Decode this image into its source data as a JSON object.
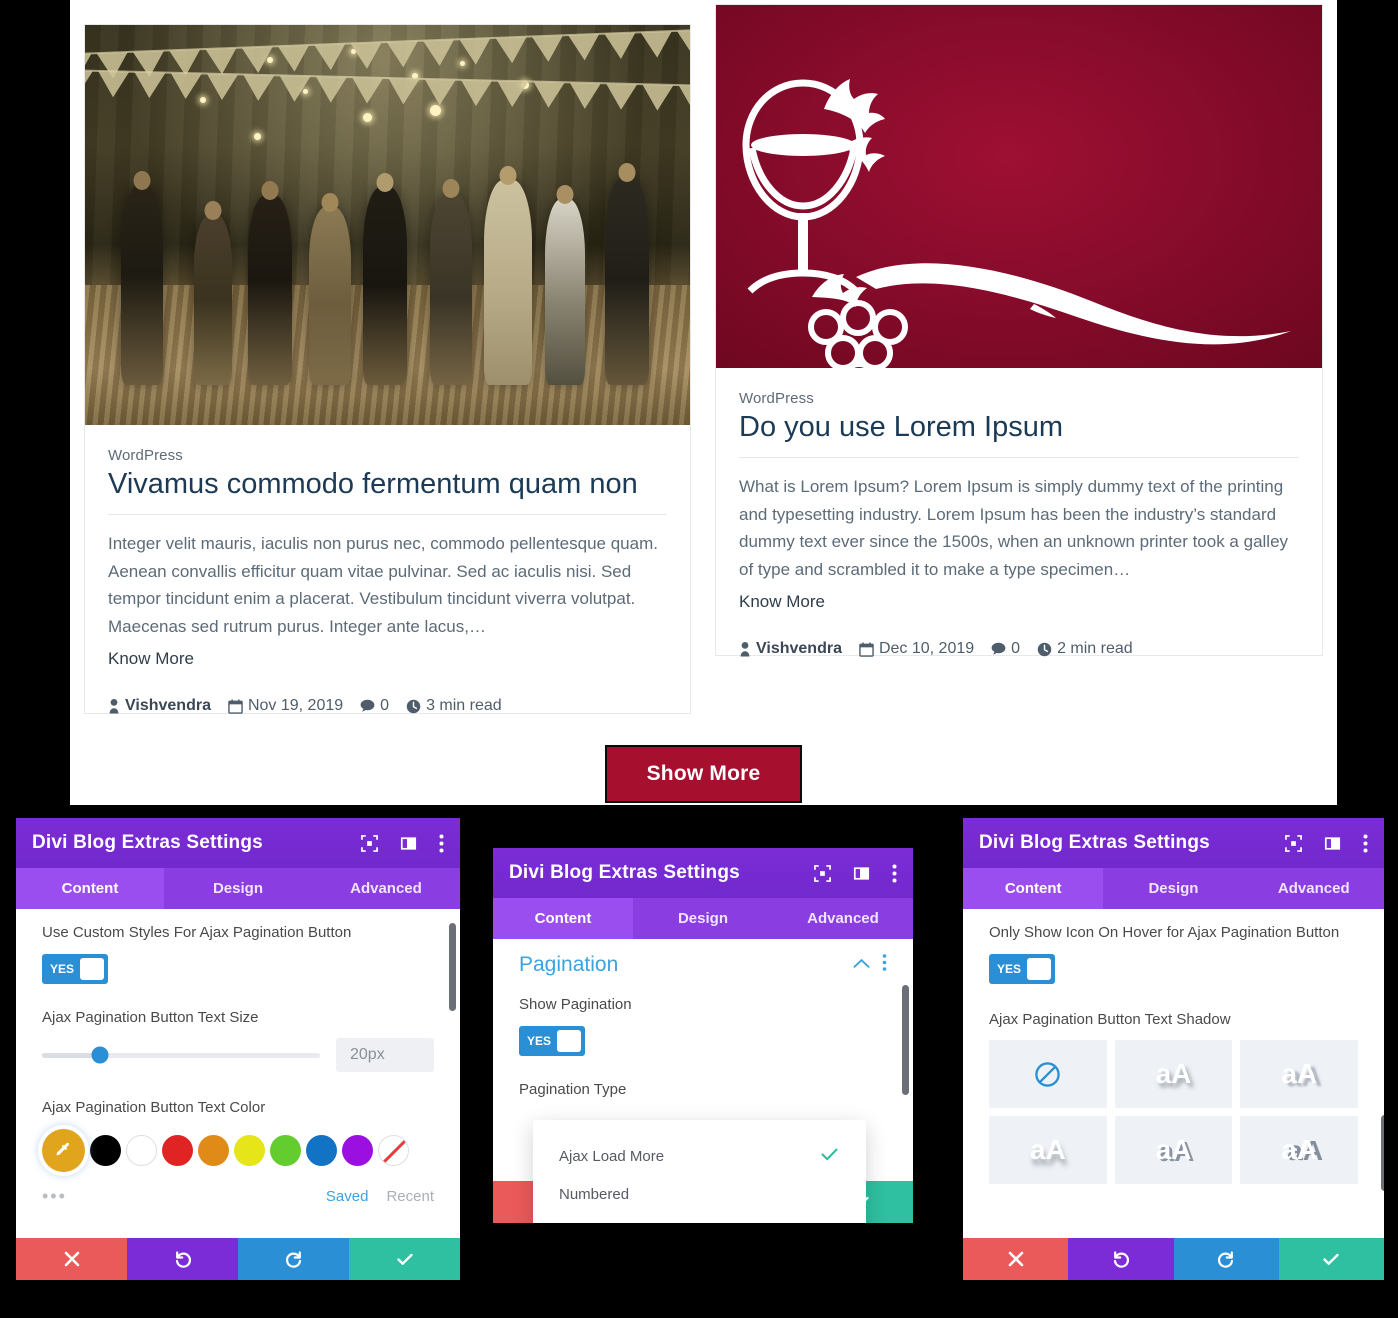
{
  "blog": {
    "posts": [
      {
        "category": "WordPress",
        "title": "Vivamus commodo fermentum quam non",
        "excerpt": "Integer velit mauris, iaculis non purus nec, commodo pellentesque quam. Aenean convallis efficitur quam vitae pulvinar. Sed ac iaculis nisi. Sed tempor tincidunt enim a placerat. Vestibulum tincidunt viverra volutpat. Maecenas sed rutrum purus. Integer ante lacus,…",
        "read_more": "Know More",
        "author": "Vishvendra",
        "date": "Nov 19, 2019",
        "comments": "0",
        "read_time": "3 min read",
        "image_name": "wedding-dance-floor-photo"
      },
      {
        "category": "WordPress",
        "title": "Do you use Lorem Ipsum",
        "excerpt": "What is Lorem Ipsum? Lorem Ipsum is simply dummy text of the printing and typesetting industry. Lorem Ipsum has been the industry’s standard dummy text ever since the 1500s, when an unknown printer took a galley of type and scrambled it to make a type specimen…",
        "read_more": "Know More",
        "author": "Vishvendra",
        "date": "Dec 10, 2019",
        "comments": "0",
        "read_time": "2 min read",
        "image_name": "wine-glass-grapes-graphic"
      }
    ],
    "show_more_label": "Show More",
    "show_more_color": "#a70f2e"
  },
  "panels": [
    {
      "title": "Divi Blog Extras Settings",
      "tabs": [
        {
          "label": "Content",
          "active": true
        },
        {
          "label": "Design",
          "active": false
        },
        {
          "label": "Advanced",
          "active": false
        }
      ],
      "fields": {
        "toggle_label": "Use Custom Styles For Ajax Pagination Button",
        "toggle_value": "YES",
        "size_label": "Ajax Pagination Button Text Size",
        "size_value": "20px",
        "color_label": "Ajax Pagination Button Text Color",
        "swatch_saved": "Saved",
        "swatch_recent": "Recent",
        "swatches": [
          "#e0a51c",
          "#000000",
          "#ffffff",
          "#e02424",
          "#e08b18",
          "#e5e519",
          "#63cc2e",
          "#1273c4",
          "#9b10e0",
          "none"
        ]
      },
      "actions": [
        "cancel-icon",
        "undo-icon",
        "redo-icon",
        "save-icon"
      ]
    },
    {
      "title": "Divi Blog Extras Settings",
      "tabs": [
        {
          "label": "Content",
          "active": true
        },
        {
          "label": "Design",
          "active": false
        },
        {
          "label": "Advanced",
          "active": false
        }
      ],
      "fields": {
        "section_title": "Pagination",
        "toggle_label": "Show Pagination",
        "toggle_value": "YES",
        "type_label": "Pagination Type",
        "dropdown_options": [
          {
            "label": "Ajax Load More",
            "selected": true
          },
          {
            "label": "Numbered",
            "selected": false
          }
        ]
      },
      "actions": [
        "cancel-icon",
        "undo-icon",
        "redo-icon",
        "save-icon"
      ]
    },
    {
      "title": "Divi Blog Extras Settings",
      "tabs": [
        {
          "label": "Content",
          "active": true
        },
        {
          "label": "Design",
          "active": false
        },
        {
          "label": "Advanced",
          "active": false
        }
      ],
      "fields": {
        "toggle_label": "Only Show Icon On Hover for Ajax Pagination Button",
        "toggle_value": "YES",
        "shadow_label": "Ajax Pagination Button Text Shadow",
        "shadow_options": [
          "none",
          "aA",
          "aA",
          "aA",
          "aA",
          "aA"
        ]
      },
      "actions": [
        "cancel-icon",
        "undo-icon",
        "redo-icon",
        "save-icon"
      ]
    }
  ],
  "colors": {
    "panel_header": "#7c2cd6",
    "tabs_bar": "#8a3de0",
    "tab_active": "#9b4ef0",
    "toggle_on": "#2a8fd4",
    "accent_blue": "#3ba3e0",
    "save_green": "#2ec0a0",
    "cancel_red": "#eb5a5a",
    "brand_crimson": "#a70f2e",
    "title_navy": "#1b3a56"
  }
}
